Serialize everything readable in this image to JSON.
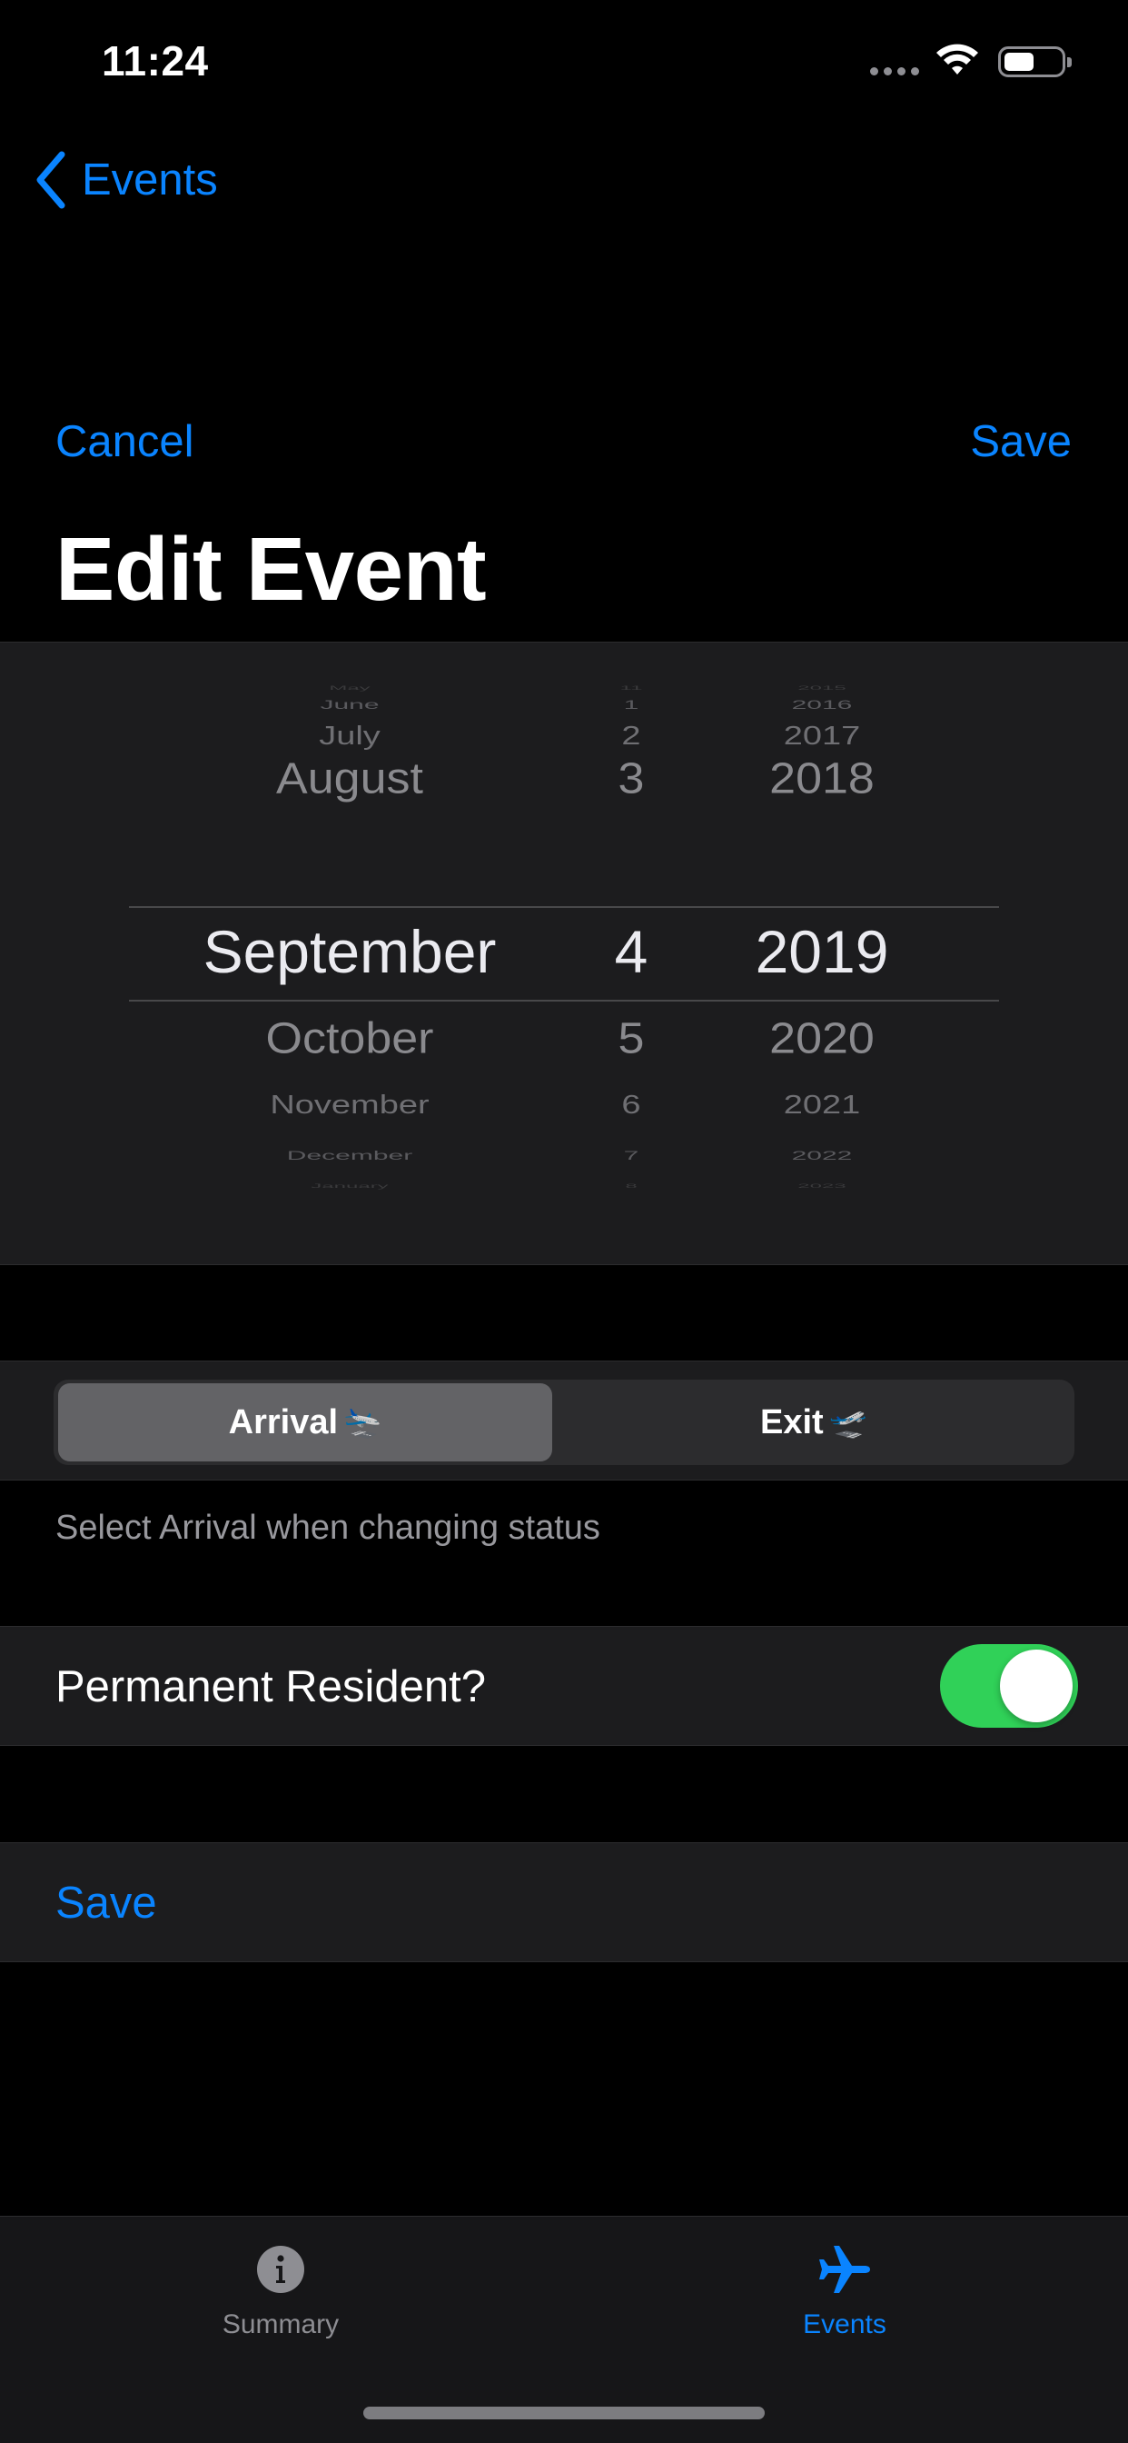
{
  "status_bar": {
    "time": "11:24",
    "icons": [
      "signal-icon",
      "wifi-icon",
      "battery-icon"
    ]
  },
  "nav": {
    "back_label": "Events"
  },
  "header": {
    "cancel_label": "Cancel",
    "save_label": "Save",
    "title": "Edit Event"
  },
  "date_picker": {
    "months": [
      "May",
      "June",
      "July",
      "August",
      "September",
      "October",
      "November",
      "December",
      "January"
    ],
    "days": [
      "11",
      "1",
      "2",
      "3",
      "4",
      "5",
      "6",
      "7",
      "8"
    ],
    "years": [
      "2015",
      "2016",
      "2017",
      "2018",
      "2019",
      "2020",
      "2021",
      "2022",
      "2023"
    ],
    "selected": {
      "month": "September",
      "day": "4",
      "year": "2019"
    }
  },
  "segmented": {
    "arrival_label": "Arrival",
    "exit_label": "Exit",
    "arrival_emoji": "🛬",
    "exit_emoji": "🛫",
    "selected": "Arrival"
  },
  "segment_footer": "Select Arrival when changing status",
  "permanent_resident": {
    "label": "Permanent Resident?",
    "value": true,
    "on_color": "#30d158"
  },
  "save_row": {
    "label": "Save"
  },
  "tab_bar": {
    "tabs": [
      {
        "label": "Summary",
        "icon": "info-circle-icon",
        "active": false
      },
      {
        "label": "Events",
        "icon": "airplane-icon",
        "active": true
      }
    ]
  },
  "colors": {
    "accent": "#0a84ff",
    "background": "#000000",
    "cell": "#1c1c1e"
  }
}
